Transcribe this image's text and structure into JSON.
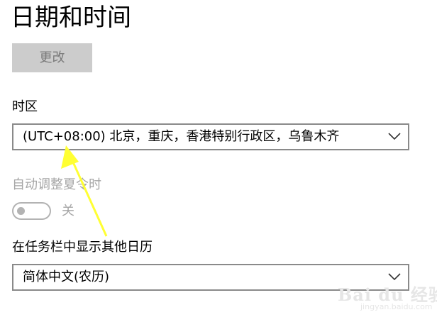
{
  "page": {
    "title": "日期和时间"
  },
  "change_button": {
    "label": "更改"
  },
  "timezone": {
    "label": "时区",
    "selected": "(UTC+08:00) 北京，重庆，香港特别行政区，乌鲁木齐"
  },
  "dst": {
    "label": "自动调整夏令时",
    "state_label": "关",
    "on": false
  },
  "calendar": {
    "label": "在任务栏中显示其他日历",
    "selected": "简体中文(农历)"
  },
  "watermark": {
    "logo": "Bai du 经验",
    "site": "jingyan.baidu.com"
  },
  "colors": {
    "annotation_arrow": "#ffff33",
    "disabled_text": "#a6a6a6",
    "button_bg": "#cccccc"
  }
}
